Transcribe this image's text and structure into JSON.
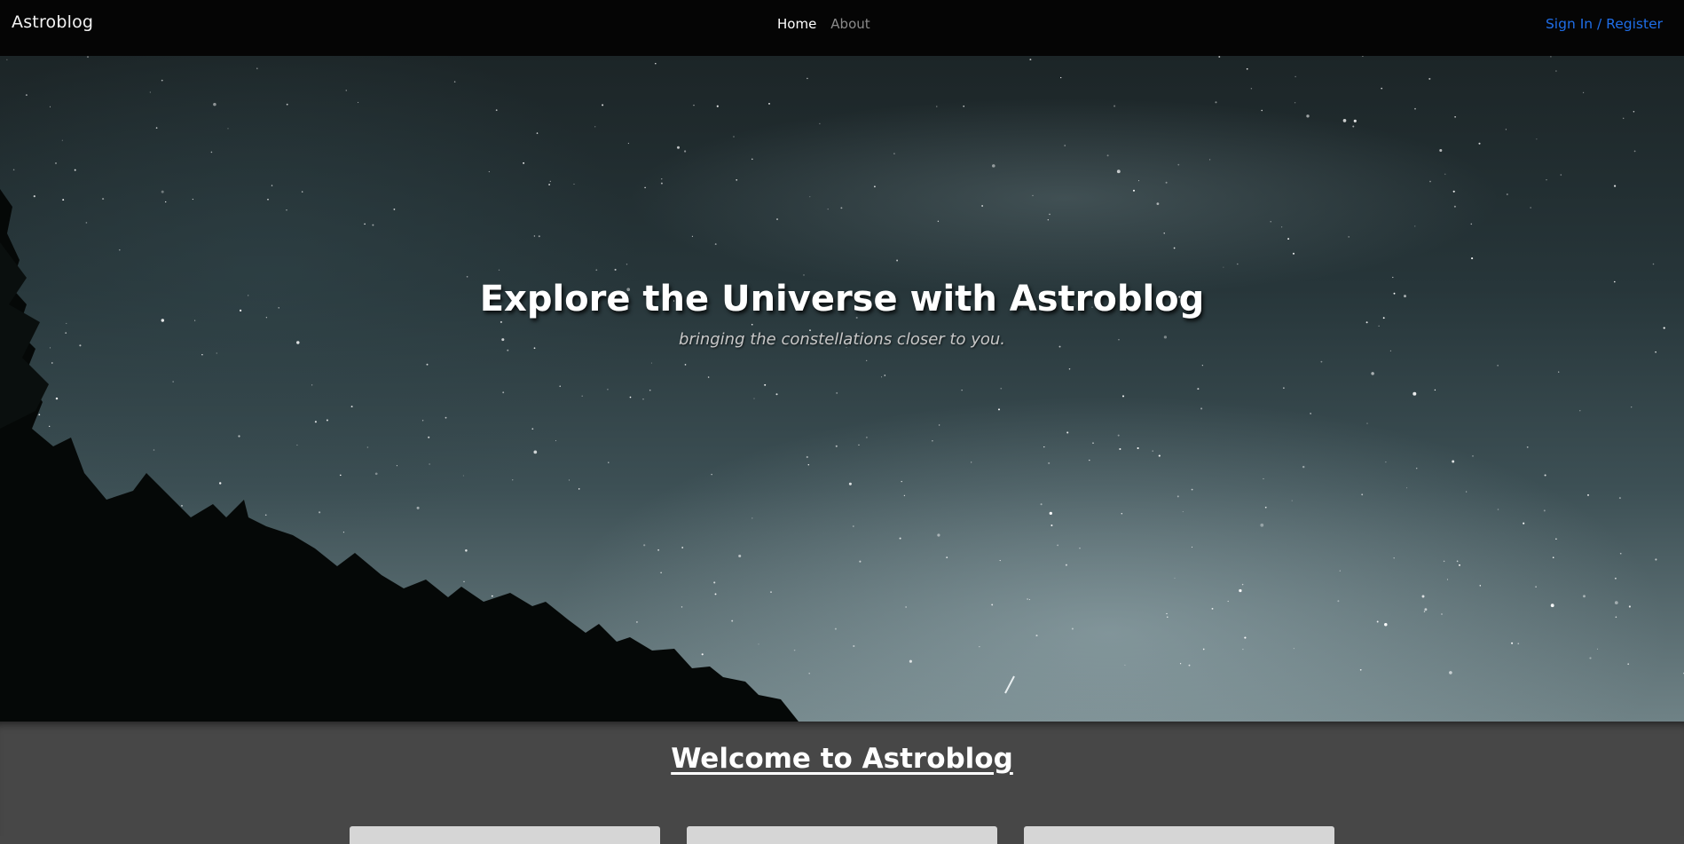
{
  "navbar": {
    "brand": "Astroblog",
    "links": [
      {
        "label": "Home",
        "active": true
      },
      {
        "label": "About",
        "active": false
      }
    ],
    "signin": "Sign In / Register"
  },
  "hero": {
    "title": "Explore the Universe with Astroblog",
    "subtitle": "bringing the constellations closer to you."
  },
  "main": {
    "heading": "Welcome to Astroblog",
    "cards": [
      {},
      {},
      {}
    ]
  },
  "colors": {
    "navbar_bg": "#050505",
    "link_accent": "#1f6ee8",
    "main_bg": "#474747",
    "card_bg": "#d6d6d6"
  }
}
